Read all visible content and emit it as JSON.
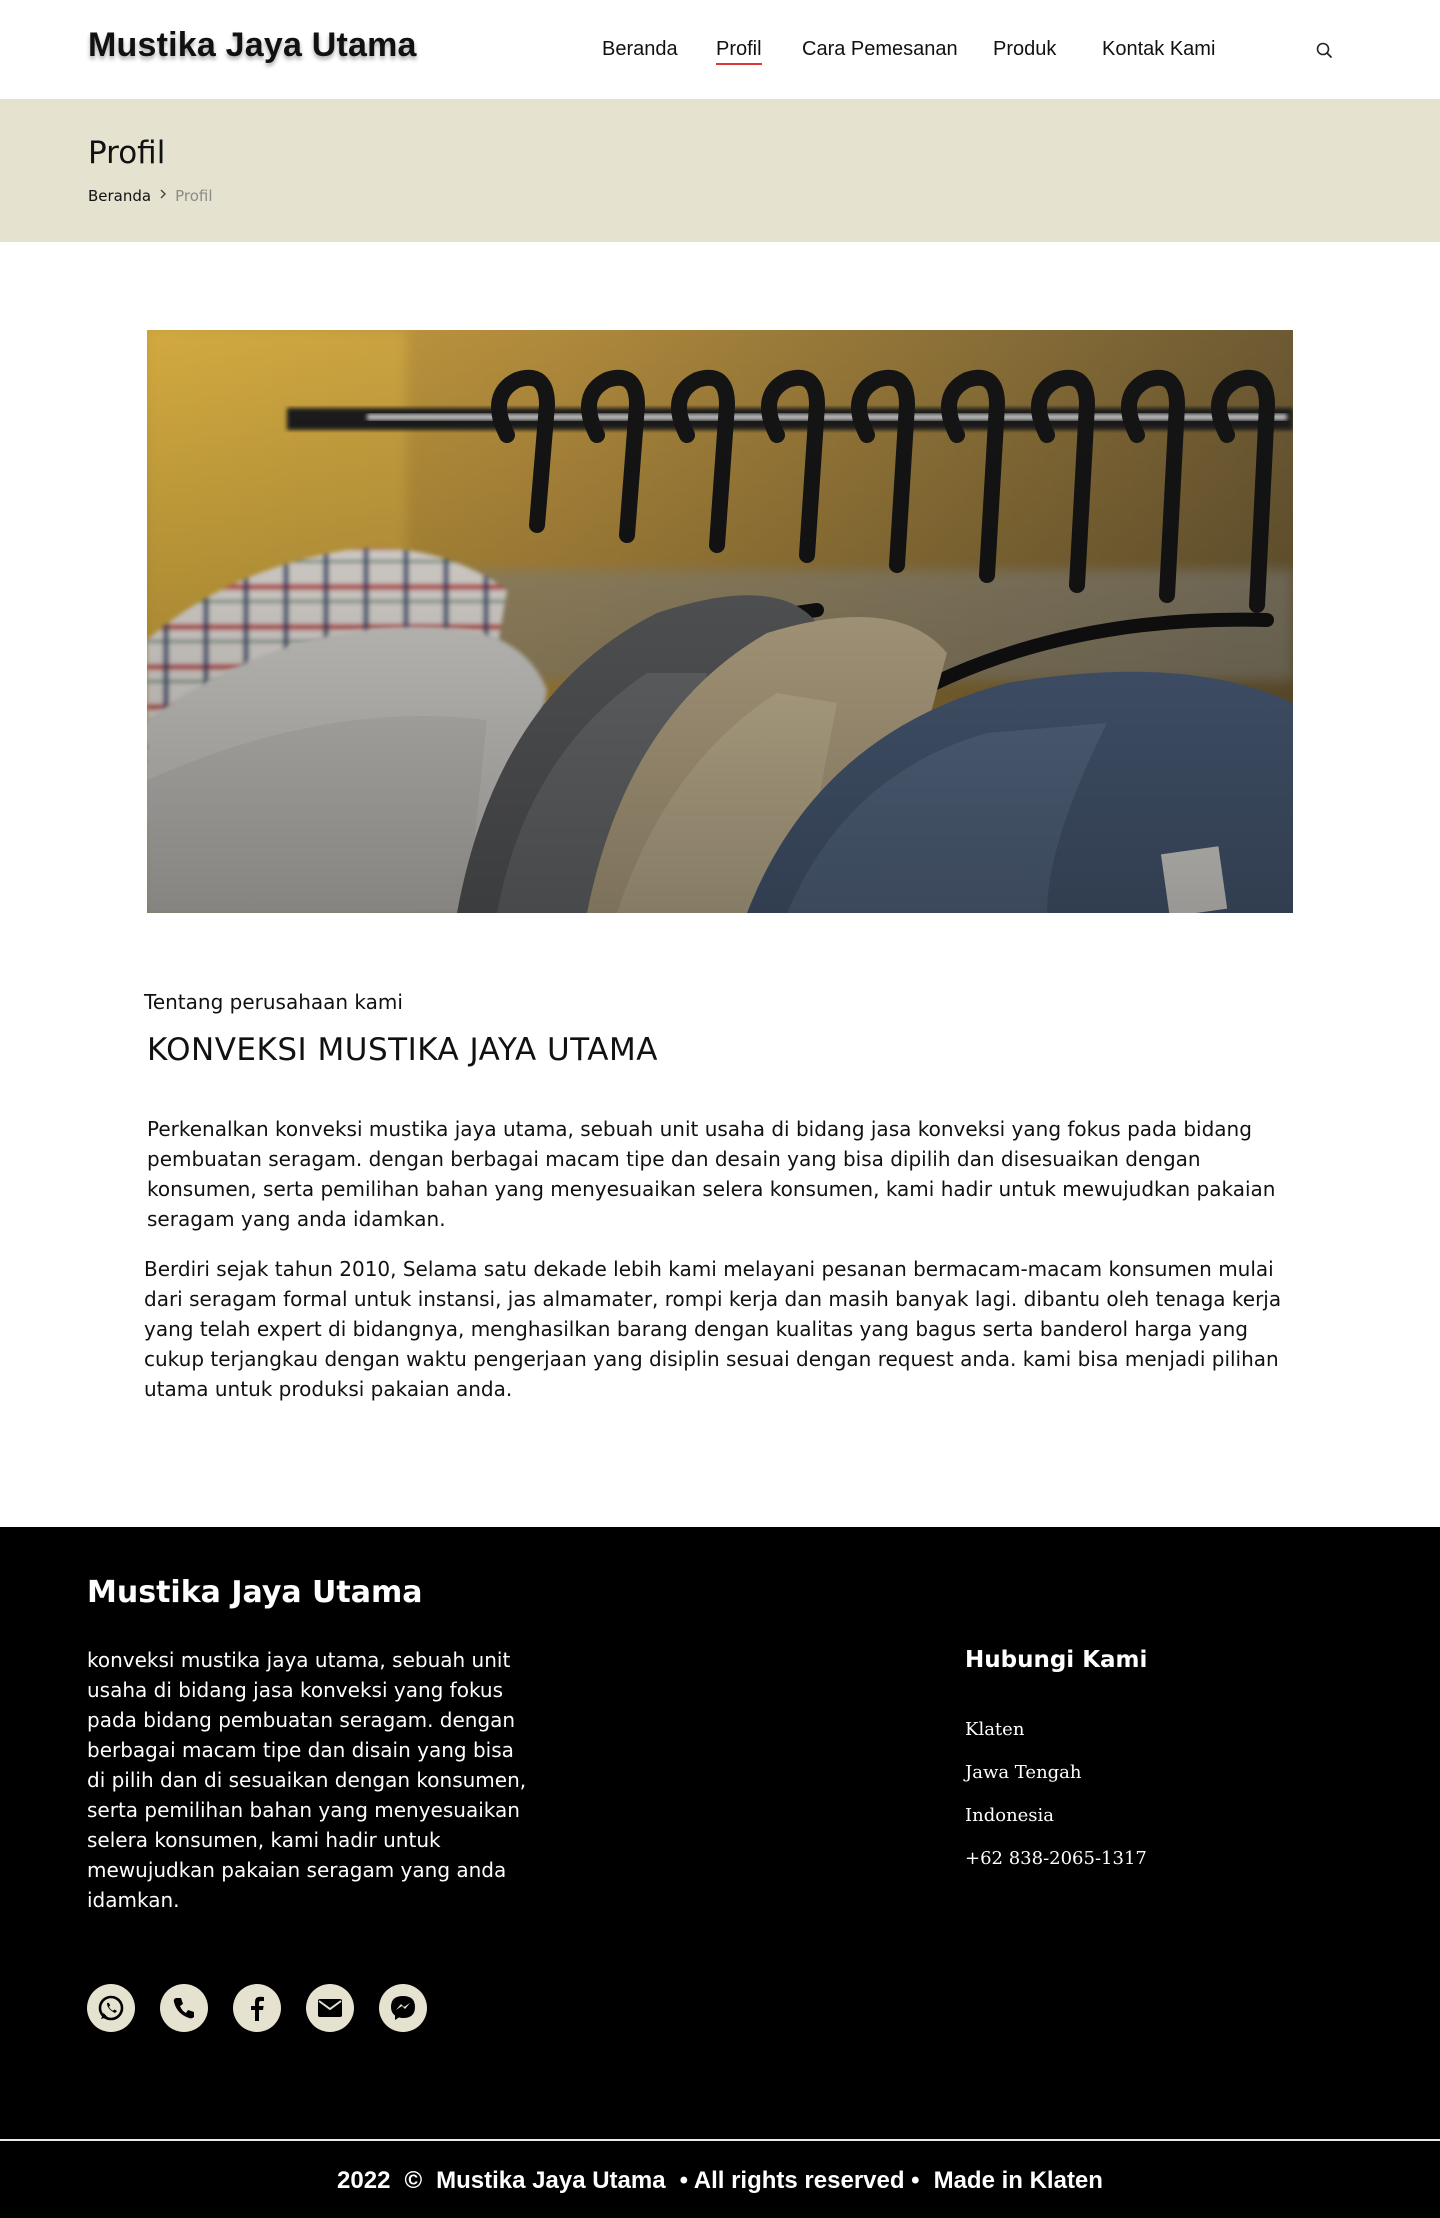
{
  "header": {
    "brand": "Mustika Jaya Utama",
    "nav": [
      {
        "label": "Beranda"
      },
      {
        "label": "Profil",
        "active": true
      },
      {
        "label": "Cara Pemesanan"
      },
      {
        "label": "Produk"
      },
      {
        "label": "Kontak Kami"
      }
    ],
    "search_icon": "search-icon"
  },
  "title_band": {
    "title": "Profil",
    "breadcrumb": {
      "home": "Beranda",
      "separator_icon": "chevron-right-icon",
      "current": "Profil"
    }
  },
  "about": {
    "kicker": "Tentang perusahaan kami",
    "heading": "KONVEKSI MUSTIKA JAYA UTAMA",
    "paragraph1": "Perkenalkan konveksi mustika jaya utama, sebuah unit usaha di bidang jasa konveksi yang fokus pada bidang pembuatan seragam. dengan berbagai macam tipe dan desain yang bisa dipilih dan disesuaikan dengan konsumen, serta pemilihan bahan yang  menyesuaikan selera konsumen, kami hadir untuk mewujudkan pakaian seragam yang anda idamkan.",
    "paragraph2": "Berdiri sejak tahun 2010, Selama satu dekade lebih kami melayani pesanan bermacam-macam konsumen mulai dari seragam formal untuk instansi, jas almamater, rompi kerja dan masih banyak lagi. dibantu oleh tenaga kerja yang telah expert di bidangnya, menghasilkan barang dengan kualitas yang bagus serta banderol harga yang cukup terjangkau dengan waktu pengerjaan yang disiplin sesuai dengan request anda. kami bisa menjadi pilihan utama untuk produksi pakaian anda."
  },
  "footer": {
    "brand": "Mustika Jaya Utama",
    "description": "konveksi mustika jaya utama, sebuah unit usaha di bidang jasa konveksi yang fokus pada bidang pembuatan seragam. dengan berbagai macam tipe dan disain yang bisa di pilih dan di sesuaikan dengan konsumen, serta pemilihan bahan yang menyesuaikan selera konsumen, kami hadir untuk mewujudkan pakaian seragam yang anda idamkan.",
    "contact_title": "Hubungi Kami",
    "contact": [
      "Klaten",
      "Jawa Tengah",
      "Indonesia",
      "+62 838-2065-1317"
    ],
    "social_icons": [
      "whatsapp-icon",
      "phone-icon",
      "facebook-icon",
      "email-icon",
      "messenger-icon"
    ],
    "copyright": {
      "year": "2022",
      "symbol": "©",
      "name": "Mustika Jaya Utama",
      "rights": "• All rights reserved •",
      "made_in": "Made in Klaten"
    }
  },
  "colors": {
    "accent_underline": "#d9373a",
    "title_band_bg": "#e6e2d0",
    "footer_bg": "#000000",
    "social_icon_bg": "#e6e2d0"
  }
}
